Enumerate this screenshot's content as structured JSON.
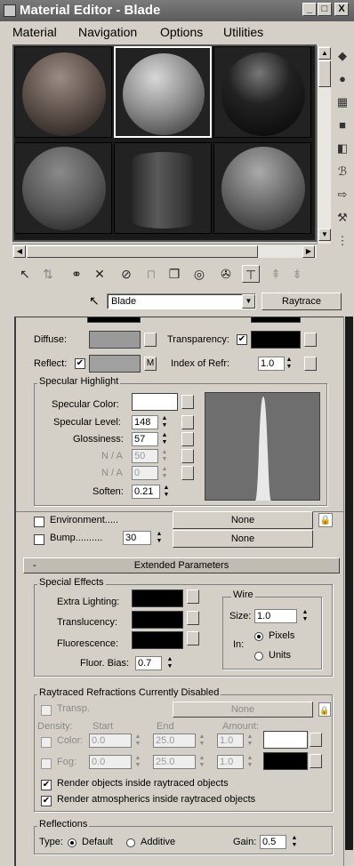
{
  "window": {
    "title": "Material Editor - Blade",
    "minimize": "_",
    "restore": "□",
    "close": "X"
  },
  "menu": [
    "Material",
    "Navigation",
    "Options",
    "Utilities"
  ],
  "name_row": {
    "material_name": "Blade",
    "type_button": "Raytrace"
  },
  "basic": {
    "diffuse_label": "Diffuse:",
    "transparency_label": "Transparency:",
    "reflect_label": "Reflect:",
    "reflect_checked": "✔",
    "transparency_checked": "✔",
    "m_button": "M",
    "index_label": "Index of Refr:",
    "index_value": "1.0"
  },
  "specular": {
    "title": "Specular Highlight",
    "color_label": "Specular Color:",
    "level_label": "Specular Level:",
    "level_value": "148",
    "gloss_label": "Glossiness:",
    "gloss_value": "57",
    "na1_label": "N / A",
    "na1_value": "50",
    "na2_label": "N / A",
    "na2_value": "0",
    "soften_label": "Soften:",
    "soften_value": "0.21"
  },
  "maps": {
    "environment_label": "Environment.....",
    "environment_map": "None",
    "bump_label": "Bump..........",
    "bump_value": "30",
    "bump_map": "None"
  },
  "extended": {
    "rollout_sign": "-",
    "rollout_title": "Extended Parameters",
    "special_title": "Special Effects",
    "extra_lighting": "Extra Lighting:",
    "translucency": "Translucency:",
    "fluorescence": "Fluorescence:",
    "fluor_bias_label": "Fluor. Bias:",
    "fluor_bias_value": "0.7",
    "wire_title": "Wire",
    "wire_size_label": "Size:",
    "wire_size_value": "1.0",
    "wire_in_label": "In:",
    "wire_pixels": "Pixels",
    "wire_units": "Units"
  },
  "raytraced": {
    "title": "Raytraced Refractions Currently Disabled",
    "transp_label": "Transp.",
    "transp_map": "None",
    "density_label": "Density:",
    "start_label": "Start",
    "end_label": "End",
    "amount_label": "Amount:",
    "color_label": "Color:",
    "color_start": "0.0",
    "color_end": "25.0",
    "color_amount": "1.0",
    "fog_label": "Fog:",
    "fog_start": "0.0",
    "fog_end": "25.0",
    "fog_amount": "1.0",
    "render_inside": "Render objects inside raytraced objects",
    "render_atmos": "Render atmospherics inside raytraced objects"
  },
  "reflections": {
    "title": "Reflections",
    "type_label": "Type:",
    "default_label": "Default",
    "additive_label": "Additive",
    "gain_label": "Gain:",
    "gain_value": "0.5"
  },
  "colors": {
    "diffuse": "#9a9a9a",
    "reflect": "#a0a0a0",
    "transparency": "#000000",
    "specular": "#ffffff",
    "graph_bg": "#6e6e6e"
  }
}
